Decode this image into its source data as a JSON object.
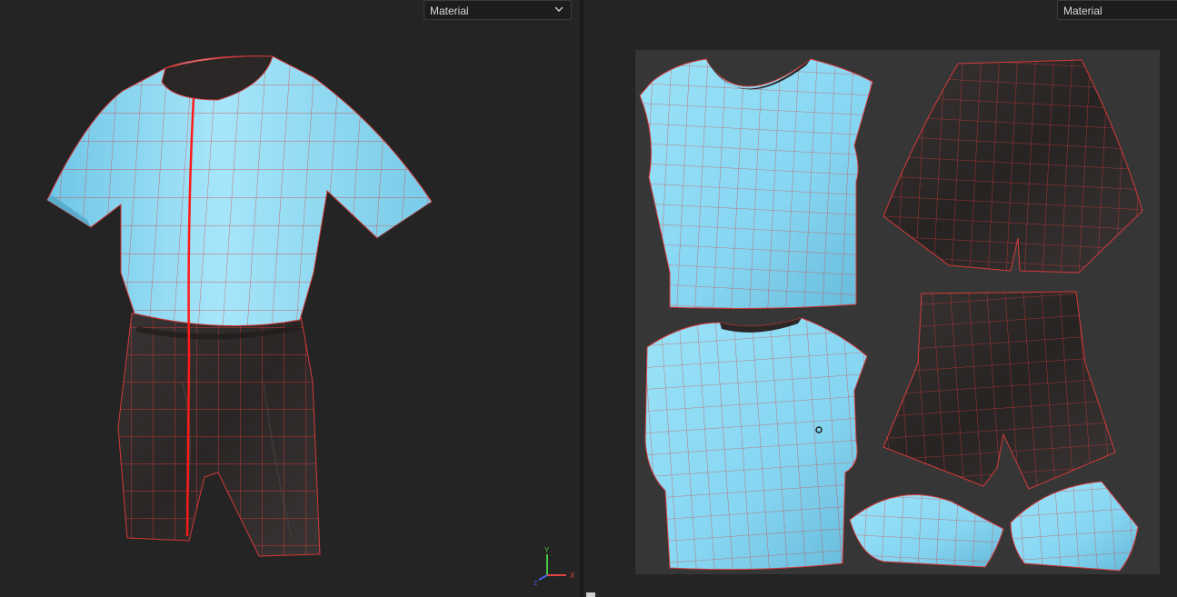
{
  "viewport_3d": {
    "shading_select": {
      "label": "Material",
      "icon": "chevron-down-icon"
    },
    "axis_gizmo": {
      "x_label": "X",
      "y_label": "Y",
      "z_label": "Z",
      "x_color": "#e04444",
      "y_color": "#44cc44",
      "z_color": "#4466ee"
    }
  },
  "viewport_2d": {
    "shading_select": {
      "label": "Material"
    }
  },
  "colors": {
    "background": "#242424",
    "uv_canvas": "#363636",
    "shirt_fabric": "#8fdcf5",
    "shorts_fabric": "#2e2a29",
    "mesh_wire": "#d43a3a",
    "seam": "#ff1a1a"
  },
  "garment": {
    "pieces": [
      "shirt-front",
      "shirt-back",
      "shorts-front",
      "shorts-back",
      "left-sleeve",
      "right-sleeve"
    ]
  }
}
